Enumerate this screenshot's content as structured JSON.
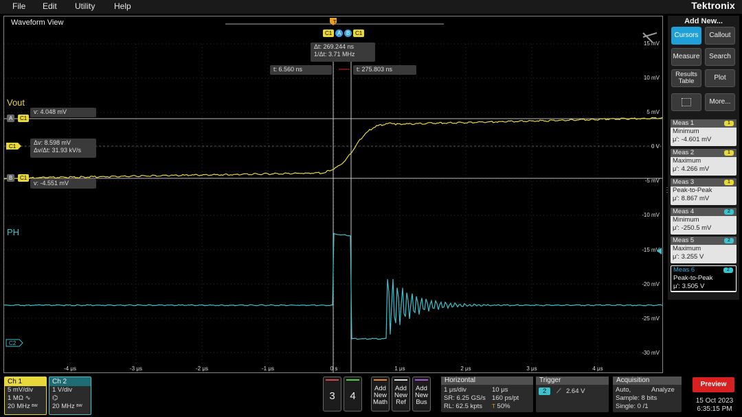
{
  "menu": {
    "items": [
      "File",
      "Edit",
      "Utility",
      "Help"
    ],
    "brand": "Tektronix"
  },
  "waveform_view": {
    "title": "Waveform View",
    "cursor_readout": {
      "delta_t": "Δt: 269.244 ns",
      "inv_delta_t": "1/Δt: 3.71 MHz",
      "t_a": "t: 6.560 ns",
      "t_b": "t: 275.803 ns"
    },
    "vout_readout": {
      "v_a": "v: 4.048 mV",
      "delta_v": "Δv: 8.598 mV",
      "dv_dt": "Δv/Δt: 31.93 kV/s",
      "v_b": "v: -4.551 mV"
    },
    "channel_labels": {
      "vout": "Vout",
      "ph": "PH"
    },
    "markers": {
      "a": "A",
      "b": "B",
      "c1": "C1",
      "c2": "C2",
      "trig": "T"
    },
    "y_tick_labels": [
      "15 mV",
      "10 mV",
      "5 mV",
      "0 V",
      "-5 mV",
      "-10 mV",
      "-15 mV",
      "-20 mV",
      "-25 mV",
      "-30 mV"
    ],
    "x_tick_labels": [
      "-4 μs",
      "-3 μs",
      "-2 μs",
      "-1 μs",
      "0 s",
      "1 μs",
      "2 μs",
      "3 μs",
      "4 μs"
    ],
    "colors": {
      "ch1": "#e8d83a",
      "ch2": "#38c4d0",
      "cursor": "#dcdcdc"
    }
  },
  "add_new": {
    "title": "Add New...",
    "buttons": [
      {
        "label": "Cursors",
        "active": true
      },
      {
        "label": "Callout"
      },
      {
        "label": "Measure"
      },
      {
        "label": "Search"
      },
      {
        "label": "Results Table"
      },
      {
        "label": "Plot"
      },
      {
        "label": ""
      },
      {
        "label": "More..."
      }
    ],
    "grid_icon": "dotted-grid-icon"
  },
  "measurements": [
    {
      "title": "Meas 1",
      "name": "Minimum",
      "value": "μ': -4.601 mV",
      "channel": "1"
    },
    {
      "title": "Meas 2",
      "name": "Maximum",
      "value": "μ': 4.266 mV",
      "channel": "1"
    },
    {
      "title": "Meas 3",
      "name": "Peak-to-Peak",
      "value": "μ': 8.867 mV",
      "channel": "1"
    },
    {
      "title": "Meas 4",
      "name": "Minimum",
      "value": "μ': -250.5 mV",
      "channel": "2"
    },
    {
      "title": "Meas 5",
      "name": "Maximum",
      "value": "μ': 3.255 V",
      "channel": "2"
    },
    {
      "title": "Meas 6",
      "name": "Peak-to-Peak",
      "value": "μ': 3.505 V",
      "channel": "2"
    }
  ],
  "bottom": {
    "ch1": {
      "title": "Ch 1",
      "scale": "5 mV/div",
      "impedance": "1 MΩ",
      "bandwidth": "20 MHz",
      "bw_icon": "bw-limit-icon",
      "coupling_icon": "ac-coupling-icon"
    },
    "ch2": {
      "title": "Ch 2",
      "scale": "1 V/div",
      "bandwidth": "20 MHz",
      "probe_icon": "probe-icon",
      "bw_icon": "bw-limit-icon"
    },
    "ch3": "3",
    "ch4": "4",
    "add_math": "Add New Math",
    "add_ref": "Add New Ref",
    "add_bus": "Add New Bus",
    "horizontal": {
      "title": "Horizontal",
      "scale": "1 μs/div",
      "duration": "10 μs",
      "sample_rate": "SR: 6.25 GS/s",
      "resolution": "160 ps/pt",
      "record_length": "RL: 62.5 kpts",
      "position": "50%",
      "trig_icon": "T"
    },
    "trigger": {
      "title": "Trigger",
      "source": "2",
      "level": "2.64 V",
      "slope_icon": "rising-edge-icon"
    },
    "acquisition": {
      "title": "Acquisition",
      "mode": "Auto,",
      "analyze": "Analyze",
      "sample": "Sample: 8 bits",
      "single": "Single: 0 /1"
    },
    "preview": "Preview",
    "date": "15 Oct 2023",
    "time": "6:35:15 PM"
  }
}
